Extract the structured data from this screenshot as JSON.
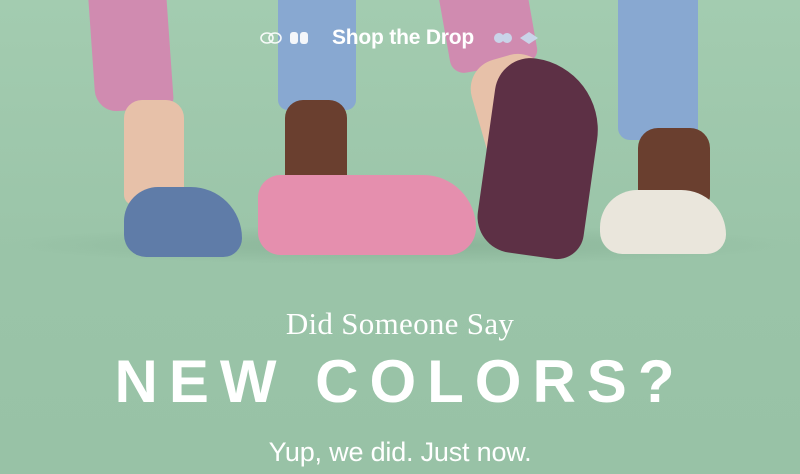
{
  "header": {
    "cta_label": "Shop the Drop",
    "left_icons": [
      "bee-logo-icon",
      "socks-logo-icon"
    ],
    "right_icons": [
      "socks-logo-icon",
      "bee-logo-icon"
    ]
  },
  "hero": {
    "subhead": "Did Someone Say",
    "headline": "NEW COLORS?",
    "tagline": "Yup, we did. Just now."
  },
  "colors": {
    "background": "#9cc6a9",
    "text": "#ffffff",
    "sock_blue": "#5f7ca8",
    "sock_pink": "#e58fae",
    "sock_purple": "#5d3045",
    "sock_cream": "#eae6dc"
  }
}
